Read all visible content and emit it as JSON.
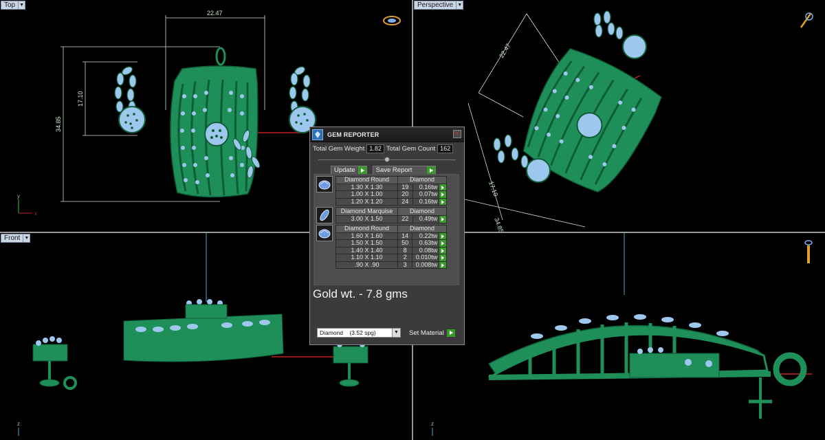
{
  "viewports": {
    "top": {
      "label": "Top",
      "dim_width": "22.47",
      "dim_height_total": "34.85",
      "dim_height_earring": "17.10",
      "axis_y": "y",
      "axis_x": "x"
    },
    "perspective": {
      "label": "Perspective",
      "dim_width": "22.47",
      "dim_earring": "17.10",
      "dim_total": "34.85"
    },
    "front": {
      "label": "Front",
      "axis_z": "z"
    },
    "right": {
      "axis_z": "z"
    }
  },
  "gem_reporter": {
    "title": "GEM REPORTER",
    "total_weight_label": "Total Gem Weight",
    "total_weight_value": "1.82",
    "total_count_label": "Total Gem Count",
    "total_count_value": "162",
    "update_label": "Update",
    "save_report_label": "Save Report",
    "groups": [
      {
        "type": "Diamond Round",
        "material": "Diamond",
        "icon": "round-gem-icon",
        "rows": [
          {
            "size": "1.30 X 1.30",
            "count": "19",
            "ct": "0.16tw"
          },
          {
            "size": "1.00 X 1.00",
            "count": "20",
            "ct": "0.07tw"
          },
          {
            "size": "1.20 X 1.20",
            "count": "24",
            "ct": "0.16tw"
          }
        ]
      },
      {
        "type": "Diamond Marquise",
        "material": "Diamond",
        "icon": "marquise-gem-icon",
        "rows": [
          {
            "size": "3.00 X 1.50",
            "count": "22",
            "ct": "0.49tw"
          }
        ]
      },
      {
        "type": "Diamond Round",
        "material": "Diamond",
        "icon": "round-gem-icon",
        "rows": [
          {
            "size": "1.60 X 1.60",
            "count": "14",
            "ct": "0.22tw"
          },
          {
            "size": "1.50 X 1.50",
            "count": "50",
            "ct": "0.63tw"
          },
          {
            "size": "1.40 X 1.40",
            "count": "8",
            "ct": "0.08tw"
          },
          {
            "size": "1.10 X 1.10",
            "count": "2",
            "ct": "0.010tw"
          },
          {
            "size": ".90 X .90",
            "count": "3",
            "ct": "0.008tw"
          }
        ]
      }
    ],
    "gold_note": "Gold wt. - 7.8 gms",
    "material_select": "Diamond    (3.52 spg)",
    "set_material_label": "Set Material"
  },
  "colors": {
    "metal": "#1f8f5a",
    "metal_dark": "#0f5d36",
    "gem": "#9ec7ee",
    "dimension": "#d4e8d4",
    "panel": "#3b3b3b",
    "accent_green": "#3b9a2c"
  }
}
